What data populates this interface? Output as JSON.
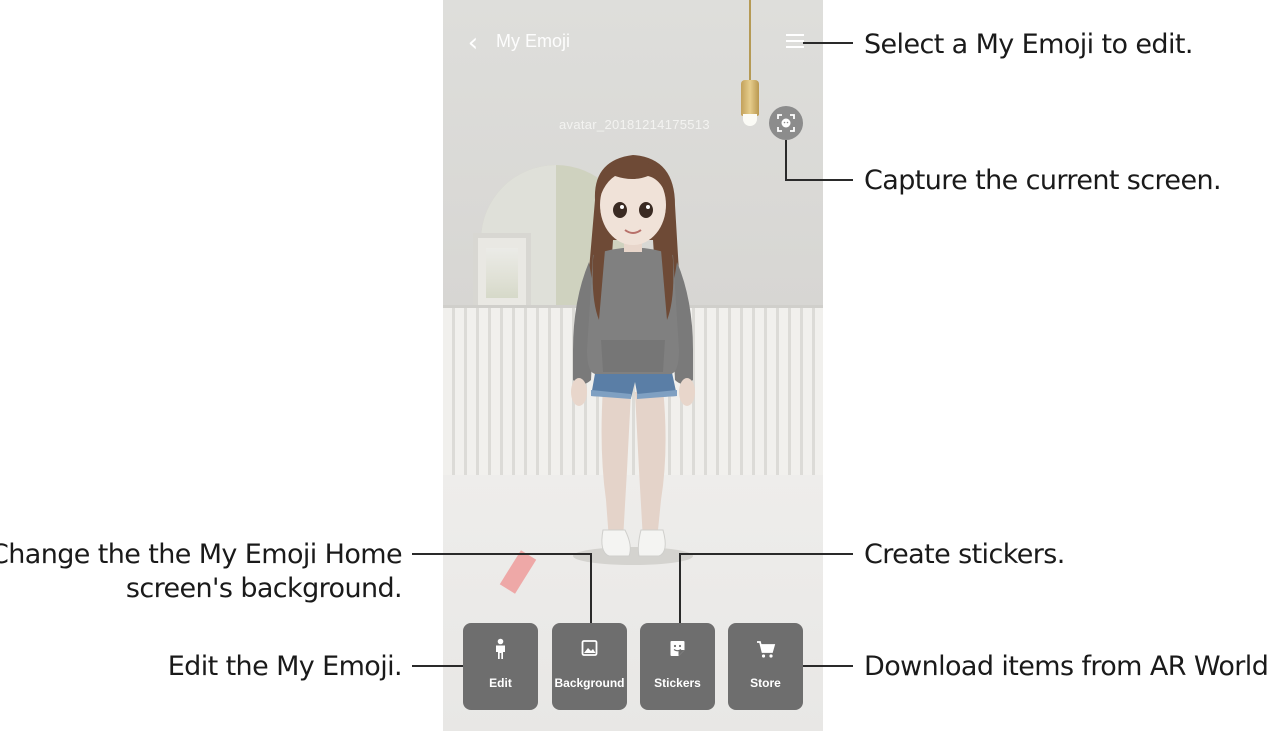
{
  "app": {
    "title": "My Emoji",
    "back_icon": "chevron-left-icon",
    "menu_icon": "menu-icon",
    "avatar_name": "avatar_20181214175513",
    "capture_icon": "face-capture-icon"
  },
  "toolbar": {
    "buttons": [
      {
        "label": "Edit",
        "icon": "person-icon"
      },
      {
        "label": "Background",
        "icon": "image-icon"
      },
      {
        "label": "Stickers",
        "icon": "sticker-icon"
      },
      {
        "label": "Store",
        "icon": "cart-icon"
      }
    ]
  },
  "callouts": {
    "menu": "Select a My Emoji to edit.",
    "capture": "Capture the current screen.",
    "background_line1": "Change the the My Emoji Home",
    "background_line2": "screen's background.",
    "stickers": "Create stickers.",
    "edit": "Edit the My Emoji.",
    "store": "Download items from AR World."
  },
  "colors": {
    "button_bg": "#6e6e6e",
    "callout_line": "#2a2a2a",
    "callout_text": "#1a1a1a"
  }
}
